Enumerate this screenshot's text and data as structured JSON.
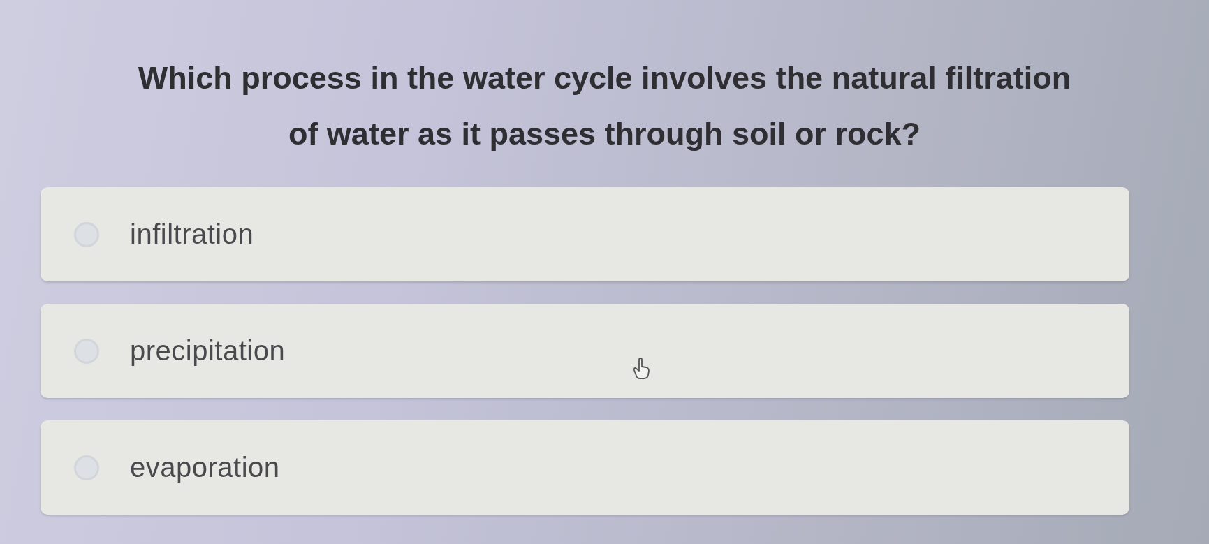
{
  "question": "Which process in the water cycle involves the natural filtration of water as it passes through soil or rock?",
  "options": [
    {
      "label": "infiltration",
      "selected": false
    },
    {
      "label": "precipitation",
      "selected": false
    },
    {
      "label": "evaporation",
      "selected": false
    }
  ]
}
